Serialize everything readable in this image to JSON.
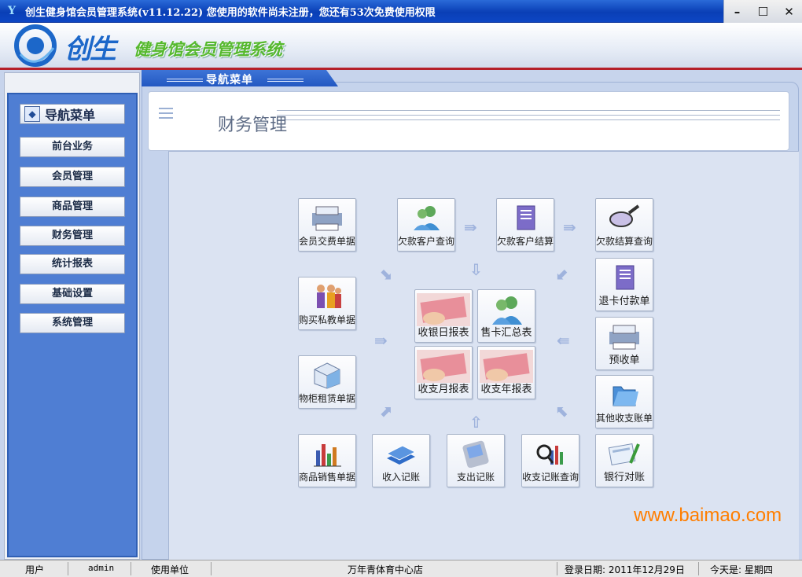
{
  "window": {
    "title": "创生健身馆会员管理系统(v11.12.22)   您使用的软件尚未注册，您还有53次免费使用权限",
    "controls": {
      "minimize": "–",
      "maximize": "☐",
      "close": "✕"
    }
  },
  "header": {
    "logo_text": "创生",
    "app_name": "健身馆会员管理系统"
  },
  "sidebar": {
    "title": "导航菜单",
    "items": [
      "前台业务",
      "会员管理",
      "商品管理",
      "财务管理",
      "统计报表",
      "基础设置",
      "系统管理"
    ]
  },
  "nav_tab": {
    "label": "导航菜单"
  },
  "page": {
    "title": "财务管理"
  },
  "tiles": {
    "member_payment": "会员交费单据",
    "owed_query": "欠款客户查询",
    "owed_settle": "欠款客户结算",
    "owed_settle_query": "欠款结算查询",
    "buy_private": "购买私教单据",
    "daily_report": "收银日报表",
    "card_summary": "售卡汇总表",
    "refund": "退卡付款单",
    "prepay": "预收单",
    "locker": "物柜租赁单据",
    "monthly_report": "收支月报表",
    "yearly_report": "收支年报表",
    "other_income": "其他收支账单",
    "goods_sales": "商品销售单据",
    "income_record": "收入记账",
    "expense_record": "支出记账",
    "record_query": "收支记账查询",
    "bank_reconcile": "银行对账"
  },
  "statusbar": {
    "user_label": "用户",
    "user_value": "admin",
    "unit_label": "使用单位",
    "unit_value": "万年青体育中心店",
    "login_date": "登录日期: 2011年12月29日",
    "today": "今天是: 星期四"
  },
  "watermark": "www.baimao.com",
  "colors": {
    "title_bar": "#0a3fb6",
    "sidebar": "#4f7ed3",
    "accent_red": "#b5202a",
    "app_name_green": "#56b92e"
  }
}
